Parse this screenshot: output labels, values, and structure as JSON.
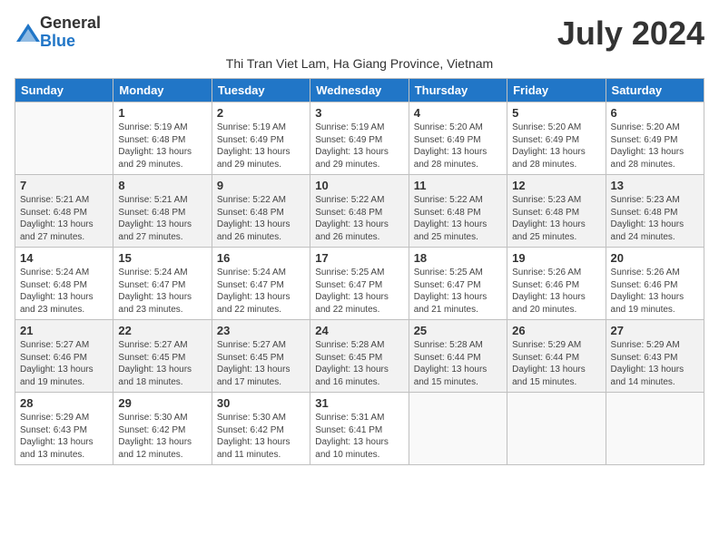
{
  "header": {
    "logo_general": "General",
    "logo_blue": "Blue",
    "month_title": "July 2024",
    "subtitle": "Thi Tran Viet Lam, Ha Giang Province, Vietnam"
  },
  "weekdays": [
    "Sunday",
    "Monday",
    "Tuesday",
    "Wednesday",
    "Thursday",
    "Friday",
    "Saturday"
  ],
  "weeks": [
    [
      {
        "day": "",
        "sunrise": "",
        "sunset": "",
        "daylight": ""
      },
      {
        "day": "1",
        "sunrise": "Sunrise: 5:19 AM",
        "sunset": "Sunset: 6:48 PM",
        "daylight": "Daylight: 13 hours and 29 minutes."
      },
      {
        "day": "2",
        "sunrise": "Sunrise: 5:19 AM",
        "sunset": "Sunset: 6:49 PM",
        "daylight": "Daylight: 13 hours and 29 minutes."
      },
      {
        "day": "3",
        "sunrise": "Sunrise: 5:19 AM",
        "sunset": "Sunset: 6:49 PM",
        "daylight": "Daylight: 13 hours and 29 minutes."
      },
      {
        "day": "4",
        "sunrise": "Sunrise: 5:20 AM",
        "sunset": "Sunset: 6:49 PM",
        "daylight": "Daylight: 13 hours and 28 minutes."
      },
      {
        "day": "5",
        "sunrise": "Sunrise: 5:20 AM",
        "sunset": "Sunset: 6:49 PM",
        "daylight": "Daylight: 13 hours and 28 minutes."
      },
      {
        "day": "6",
        "sunrise": "Sunrise: 5:20 AM",
        "sunset": "Sunset: 6:49 PM",
        "daylight": "Daylight: 13 hours and 28 minutes."
      }
    ],
    [
      {
        "day": "7",
        "sunrise": "Sunrise: 5:21 AM",
        "sunset": "Sunset: 6:48 PM",
        "daylight": "Daylight: 13 hours and 27 minutes."
      },
      {
        "day": "8",
        "sunrise": "Sunrise: 5:21 AM",
        "sunset": "Sunset: 6:48 PM",
        "daylight": "Daylight: 13 hours and 27 minutes."
      },
      {
        "day": "9",
        "sunrise": "Sunrise: 5:22 AM",
        "sunset": "Sunset: 6:48 PM",
        "daylight": "Daylight: 13 hours and 26 minutes."
      },
      {
        "day": "10",
        "sunrise": "Sunrise: 5:22 AM",
        "sunset": "Sunset: 6:48 PM",
        "daylight": "Daylight: 13 hours and 26 minutes."
      },
      {
        "day": "11",
        "sunrise": "Sunrise: 5:22 AM",
        "sunset": "Sunset: 6:48 PM",
        "daylight": "Daylight: 13 hours and 25 minutes."
      },
      {
        "day": "12",
        "sunrise": "Sunrise: 5:23 AM",
        "sunset": "Sunset: 6:48 PM",
        "daylight": "Daylight: 13 hours and 25 minutes."
      },
      {
        "day": "13",
        "sunrise": "Sunrise: 5:23 AM",
        "sunset": "Sunset: 6:48 PM",
        "daylight": "Daylight: 13 hours and 24 minutes."
      }
    ],
    [
      {
        "day": "14",
        "sunrise": "Sunrise: 5:24 AM",
        "sunset": "Sunset: 6:48 PM",
        "daylight": "Daylight: 13 hours and 23 minutes."
      },
      {
        "day": "15",
        "sunrise": "Sunrise: 5:24 AM",
        "sunset": "Sunset: 6:47 PM",
        "daylight": "Daylight: 13 hours and 23 minutes."
      },
      {
        "day": "16",
        "sunrise": "Sunrise: 5:24 AM",
        "sunset": "Sunset: 6:47 PM",
        "daylight": "Daylight: 13 hours and 22 minutes."
      },
      {
        "day": "17",
        "sunrise": "Sunrise: 5:25 AM",
        "sunset": "Sunset: 6:47 PM",
        "daylight": "Daylight: 13 hours and 22 minutes."
      },
      {
        "day": "18",
        "sunrise": "Sunrise: 5:25 AM",
        "sunset": "Sunset: 6:47 PM",
        "daylight": "Daylight: 13 hours and 21 minutes."
      },
      {
        "day": "19",
        "sunrise": "Sunrise: 5:26 AM",
        "sunset": "Sunset: 6:46 PM",
        "daylight": "Daylight: 13 hours and 20 minutes."
      },
      {
        "day": "20",
        "sunrise": "Sunrise: 5:26 AM",
        "sunset": "Sunset: 6:46 PM",
        "daylight": "Daylight: 13 hours and 19 minutes."
      }
    ],
    [
      {
        "day": "21",
        "sunrise": "Sunrise: 5:27 AM",
        "sunset": "Sunset: 6:46 PM",
        "daylight": "Daylight: 13 hours and 19 minutes."
      },
      {
        "day": "22",
        "sunrise": "Sunrise: 5:27 AM",
        "sunset": "Sunset: 6:45 PM",
        "daylight": "Daylight: 13 hours and 18 minutes."
      },
      {
        "day": "23",
        "sunrise": "Sunrise: 5:27 AM",
        "sunset": "Sunset: 6:45 PM",
        "daylight": "Daylight: 13 hours and 17 minutes."
      },
      {
        "day": "24",
        "sunrise": "Sunrise: 5:28 AM",
        "sunset": "Sunset: 6:45 PM",
        "daylight": "Daylight: 13 hours and 16 minutes."
      },
      {
        "day": "25",
        "sunrise": "Sunrise: 5:28 AM",
        "sunset": "Sunset: 6:44 PM",
        "daylight": "Daylight: 13 hours and 15 minutes."
      },
      {
        "day": "26",
        "sunrise": "Sunrise: 5:29 AM",
        "sunset": "Sunset: 6:44 PM",
        "daylight": "Daylight: 13 hours and 15 minutes."
      },
      {
        "day": "27",
        "sunrise": "Sunrise: 5:29 AM",
        "sunset": "Sunset: 6:43 PM",
        "daylight": "Daylight: 13 hours and 14 minutes."
      }
    ],
    [
      {
        "day": "28",
        "sunrise": "Sunrise: 5:29 AM",
        "sunset": "Sunset: 6:43 PM",
        "daylight": "Daylight: 13 hours and 13 minutes."
      },
      {
        "day": "29",
        "sunrise": "Sunrise: 5:30 AM",
        "sunset": "Sunset: 6:42 PM",
        "daylight": "Daylight: 13 hours and 12 minutes."
      },
      {
        "day": "30",
        "sunrise": "Sunrise: 5:30 AM",
        "sunset": "Sunset: 6:42 PM",
        "daylight": "Daylight: 13 hours and 11 minutes."
      },
      {
        "day": "31",
        "sunrise": "Sunrise: 5:31 AM",
        "sunset": "Sunset: 6:41 PM",
        "daylight": "Daylight: 13 hours and 10 minutes."
      },
      {
        "day": "",
        "sunrise": "",
        "sunset": "",
        "daylight": ""
      },
      {
        "day": "",
        "sunrise": "",
        "sunset": "",
        "daylight": ""
      },
      {
        "day": "",
        "sunrise": "",
        "sunset": "",
        "daylight": ""
      }
    ]
  ]
}
